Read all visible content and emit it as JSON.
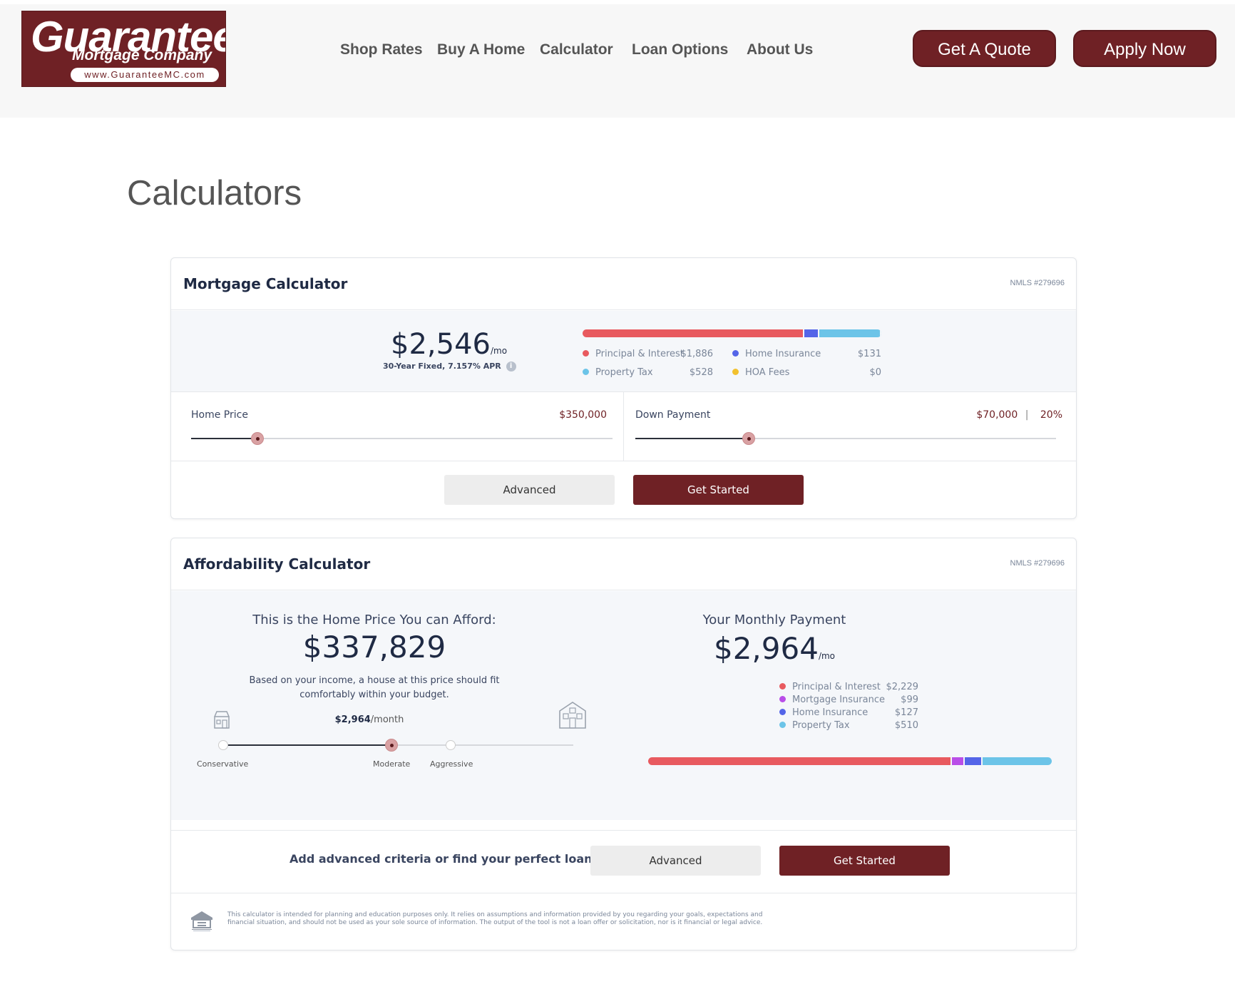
{
  "header": {
    "logo": {
      "main": "Guarantee",
      "sub": "Mortgage Company",
      "url": "www.GuaranteeMC.com"
    },
    "nav": [
      "Shop Rates",
      "Buy A Home",
      "Calculator",
      "Loan Options",
      "About Us"
    ],
    "quote_button": "Get A Quote",
    "apply_button": "Apply Now"
  },
  "page": {
    "title": "Calculators"
  },
  "mortgage": {
    "title": "Mortgage Calculator",
    "nmls": "NMLS #279696",
    "payment": "$2,546",
    "per": "/mo",
    "subtitle": "30-Year Fixed, 7.157% APR",
    "breakdown": [
      {
        "label": "Principal & Interest",
        "value": "$1,886",
        "amount": 1886,
        "color": "#e85a5f"
      },
      {
        "label": "Home Insurance",
        "value": "$131",
        "amount": 131,
        "color": "#5465e8"
      },
      {
        "label": "Property Tax",
        "value": "$528",
        "amount": 528,
        "color": "#6cc4e8"
      },
      {
        "label": "HOA Fees",
        "value": "$0",
        "amount": 0,
        "color": "#f2c12e"
      }
    ],
    "home_price": {
      "label": "Home Price",
      "value": "$350,000",
      "position": 0.157
    },
    "down_payment": {
      "label": "Down Payment",
      "value": "$70,000",
      "separator": "|",
      "percent": "20%",
      "position": 0.27
    },
    "advanced_button": "Advanced",
    "start_button": "Get Started"
  },
  "affordability": {
    "title": "Affordability Calculator",
    "nmls": "NMLS #279696",
    "afford_heading": "This is the Home Price You can Afford:",
    "afford_amount": "$337,829",
    "afford_desc_1": "Based on your income, a house at this price should fit",
    "afford_desc_2": "comfortably within your budget.",
    "slider_payment": "$2,964",
    "slider_per": "/month",
    "slider_position": 0.48,
    "steps": [
      "Conservative",
      "Moderate",
      "Aggressive"
    ],
    "monthly_heading": "Your Monthly Payment",
    "monthly_amount": "$2,964",
    "monthly_per": "/mo",
    "breakdown": [
      {
        "label": "Principal & Interest",
        "value": "$2,229",
        "amount": 2229,
        "color": "#e85a5f"
      },
      {
        "label": "Mortgage Insurance",
        "value": "$99",
        "amount": 99,
        "color": "#b94ee8"
      },
      {
        "label": "Home Insurance",
        "value": "$127",
        "amount": 127,
        "color": "#5465e8"
      },
      {
        "label": "Property Tax",
        "value": "$510",
        "amount": 510,
        "color": "#6cc4e8"
      }
    ],
    "cta_text": "Add advanced criteria or find your perfect loan.",
    "advanced_button": "Advanced",
    "start_button": "Get Started",
    "disclaimer_1": "This calculator is intended for planning and education purposes only. It relies on assumptions and information provided by you regarding your goals, expectations and",
    "disclaimer_2": "financial situation, and should not be used as your sole source of information. The output of the tool is not a loan offer or solicitation, nor is it financial or legal advice."
  }
}
